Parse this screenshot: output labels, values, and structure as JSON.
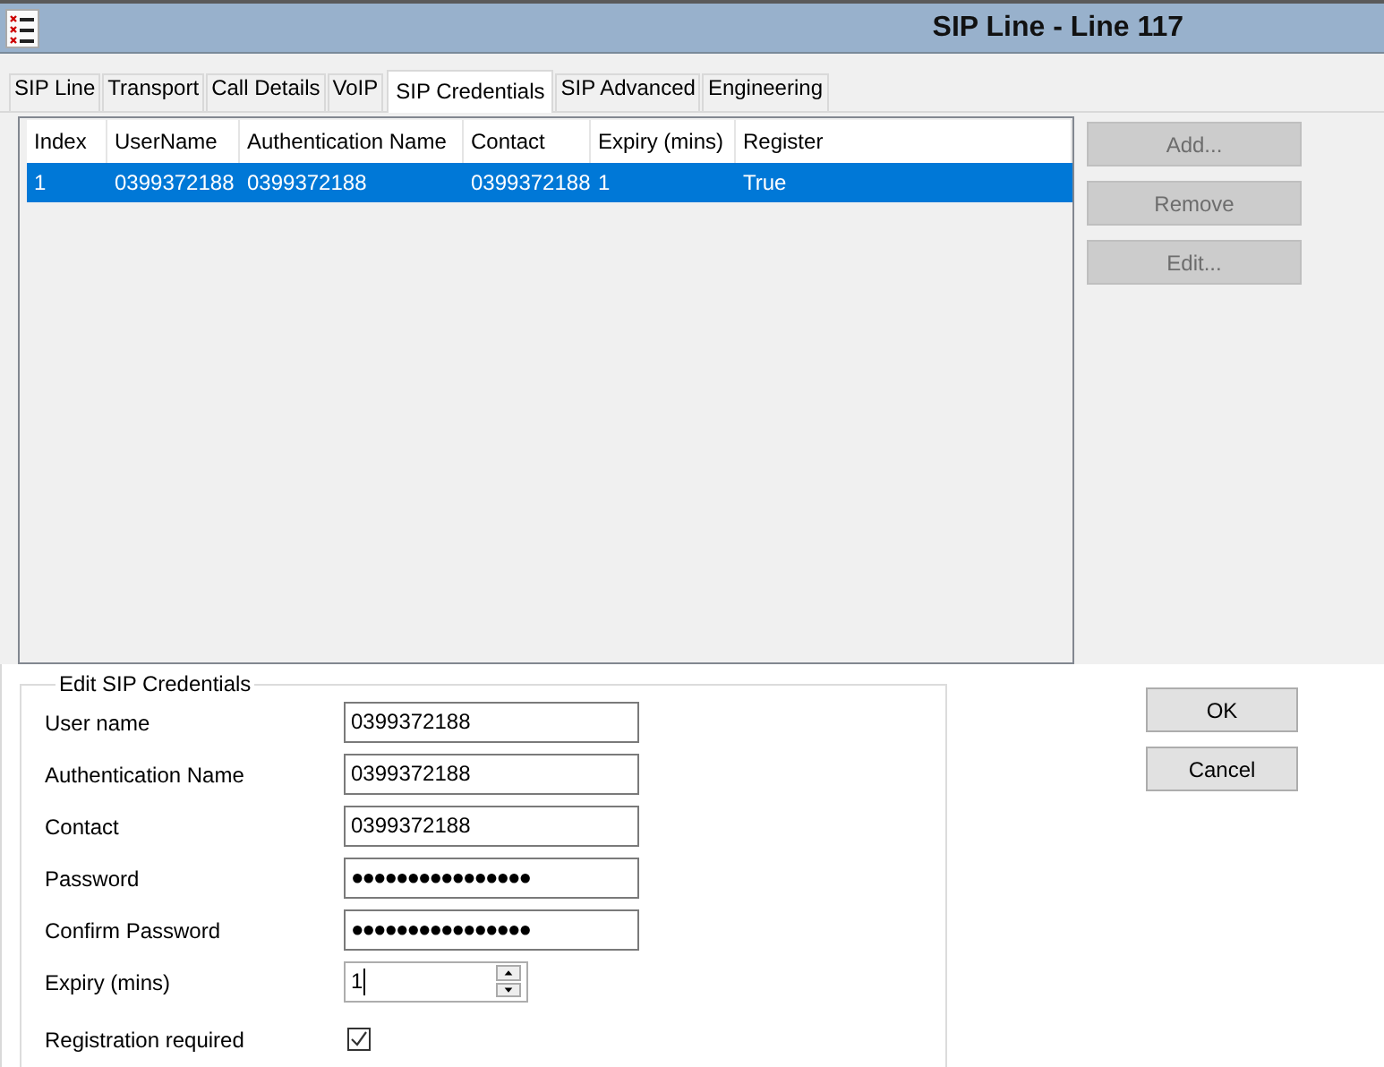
{
  "window": {
    "title": "SIP Line - Line 117"
  },
  "tabs": [
    {
      "label": "SIP Line",
      "selected": false
    },
    {
      "label": "Transport",
      "selected": false
    },
    {
      "label": "Call Details",
      "selected": false
    },
    {
      "label": "VoIP",
      "selected": false
    },
    {
      "label": "SIP Credentials",
      "selected": true
    },
    {
      "label": "SIP Advanced",
      "selected": false
    },
    {
      "label": "Engineering",
      "selected": false
    }
  ],
  "table": {
    "columns": [
      "Index",
      "UserName",
      "Authentication Name",
      "Contact",
      "Expiry (mins)",
      "Register"
    ],
    "rows": [
      {
        "cells": [
          "1",
          "0399372188",
          "0399372188",
          "0399372188",
          "1",
          "True"
        ],
        "selected": true
      }
    ]
  },
  "side_buttons": [
    {
      "label": "Add...",
      "disabled": true
    },
    {
      "label": "Remove",
      "disabled": true
    },
    {
      "label": "Edit...",
      "disabled": true
    }
  ],
  "edit_group": {
    "title": "Edit SIP Credentials",
    "fields": [
      {
        "kind": "text",
        "label": "User name",
        "value": "0399372188"
      },
      {
        "kind": "text",
        "label": "Authentication Name",
        "value": "0399372188"
      },
      {
        "kind": "text",
        "label": "Contact",
        "value": "0399372188"
      },
      {
        "kind": "password",
        "label": "Password",
        "value": "●●●●●●●●●●●●●●●●"
      },
      {
        "kind": "password",
        "label": "Confirm Password",
        "value": "●●●●●●●●●●●●●●●●"
      },
      {
        "kind": "spinner",
        "label": "Expiry (mins)",
        "value": "1"
      },
      {
        "kind": "checkbox",
        "label": "Registration required",
        "checked": true
      }
    ]
  },
  "dialog_buttons": [
    "OK",
    "Cancel"
  ]
}
